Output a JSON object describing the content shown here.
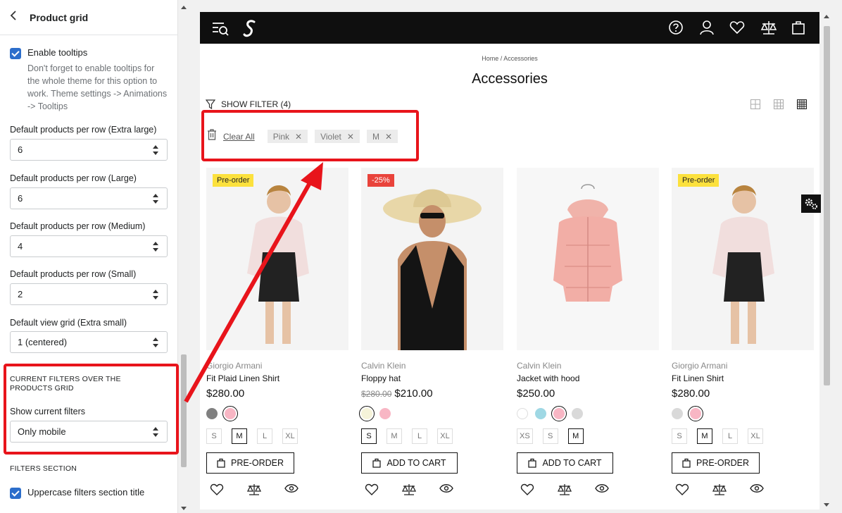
{
  "panel": {
    "title": "Product grid",
    "enable_tooltips": "Enable tooltips",
    "tooltips_help": "Don't forget to enable tooltips for the whole theme for this option to work. Theme settings -> Animations -> Tooltips",
    "fields": [
      {
        "label": "Default products per row (Extra large)",
        "value": "6"
      },
      {
        "label": "Default products per row (Large)",
        "value": "6"
      },
      {
        "label": "Default products per row (Medium)",
        "value": "4"
      },
      {
        "label": "Default products per row (Small)",
        "value": "2"
      },
      {
        "label": "Default view grid (Extra small)",
        "value": "1 (centered)"
      }
    ],
    "current_filters_heading": "CURRENT FILTERS OVER THE PRODUCTS GRID",
    "show_current_filters_label": "Show current filters",
    "show_current_filters_value": "Only mobile",
    "filters_section_heading": "FILTERS SECTION",
    "uppercase_title": "Uppercase filters section title"
  },
  "store": {
    "breadcrumb": "Home  /  Accessories",
    "title": "Accessories",
    "show_filter": "SHOW FILTER (4)",
    "clear_all": "Clear All",
    "active_filters": [
      "Pink",
      "Violet",
      "M"
    ],
    "products": [
      {
        "badge": "Pre-order",
        "brand": "Giorgio Armani",
        "name": "Fit Plaid Linen Shirt",
        "old_price": "",
        "price": "$280.00",
        "swatches": [
          "#808080",
          "#f8b6c4"
        ],
        "sizes": [
          "S",
          "M",
          "L",
          "XL"
        ],
        "selected_size": "M",
        "button": "PRE-ORDER"
      },
      {
        "badge": "-25%",
        "brand": "Calvin Klein",
        "name": "Floppy hat",
        "old_price": "$280.00",
        "price": "$210.00",
        "swatches": [
          "#f5f3d9",
          "#f8b6c4"
        ],
        "sizes": [
          "S",
          "M",
          "L",
          "XL"
        ],
        "selected_size": "S",
        "button": "ADD TO CART"
      },
      {
        "badge": "",
        "brand": "Calvin Klein",
        "name": "Jacket with hood",
        "old_price": "",
        "price": "$250.00",
        "swatches": [
          "#ffffff",
          "#9fd8e4",
          "#f8b6c4",
          "#d9d9d9"
        ],
        "sizes": [
          "XS",
          "S",
          "M"
        ],
        "selected_size": "M",
        "button": "ADD TO CART"
      },
      {
        "badge": "Pre-order",
        "brand": "Giorgio Armani",
        "name": "Fit Linen Shirt",
        "old_price": "",
        "price": "$280.00",
        "swatches": [
          "#d9d9d9",
          "#f8b6c4"
        ],
        "sizes": [
          "S",
          "M",
          "L",
          "XL"
        ],
        "selected_size": "M",
        "button": "PRE-ORDER"
      }
    ]
  },
  "colors": {
    "accent": "#2c6ecb",
    "highlight": "#e8141b",
    "badge_preorder": "#fce13d",
    "badge_sale": "#e9433b"
  }
}
